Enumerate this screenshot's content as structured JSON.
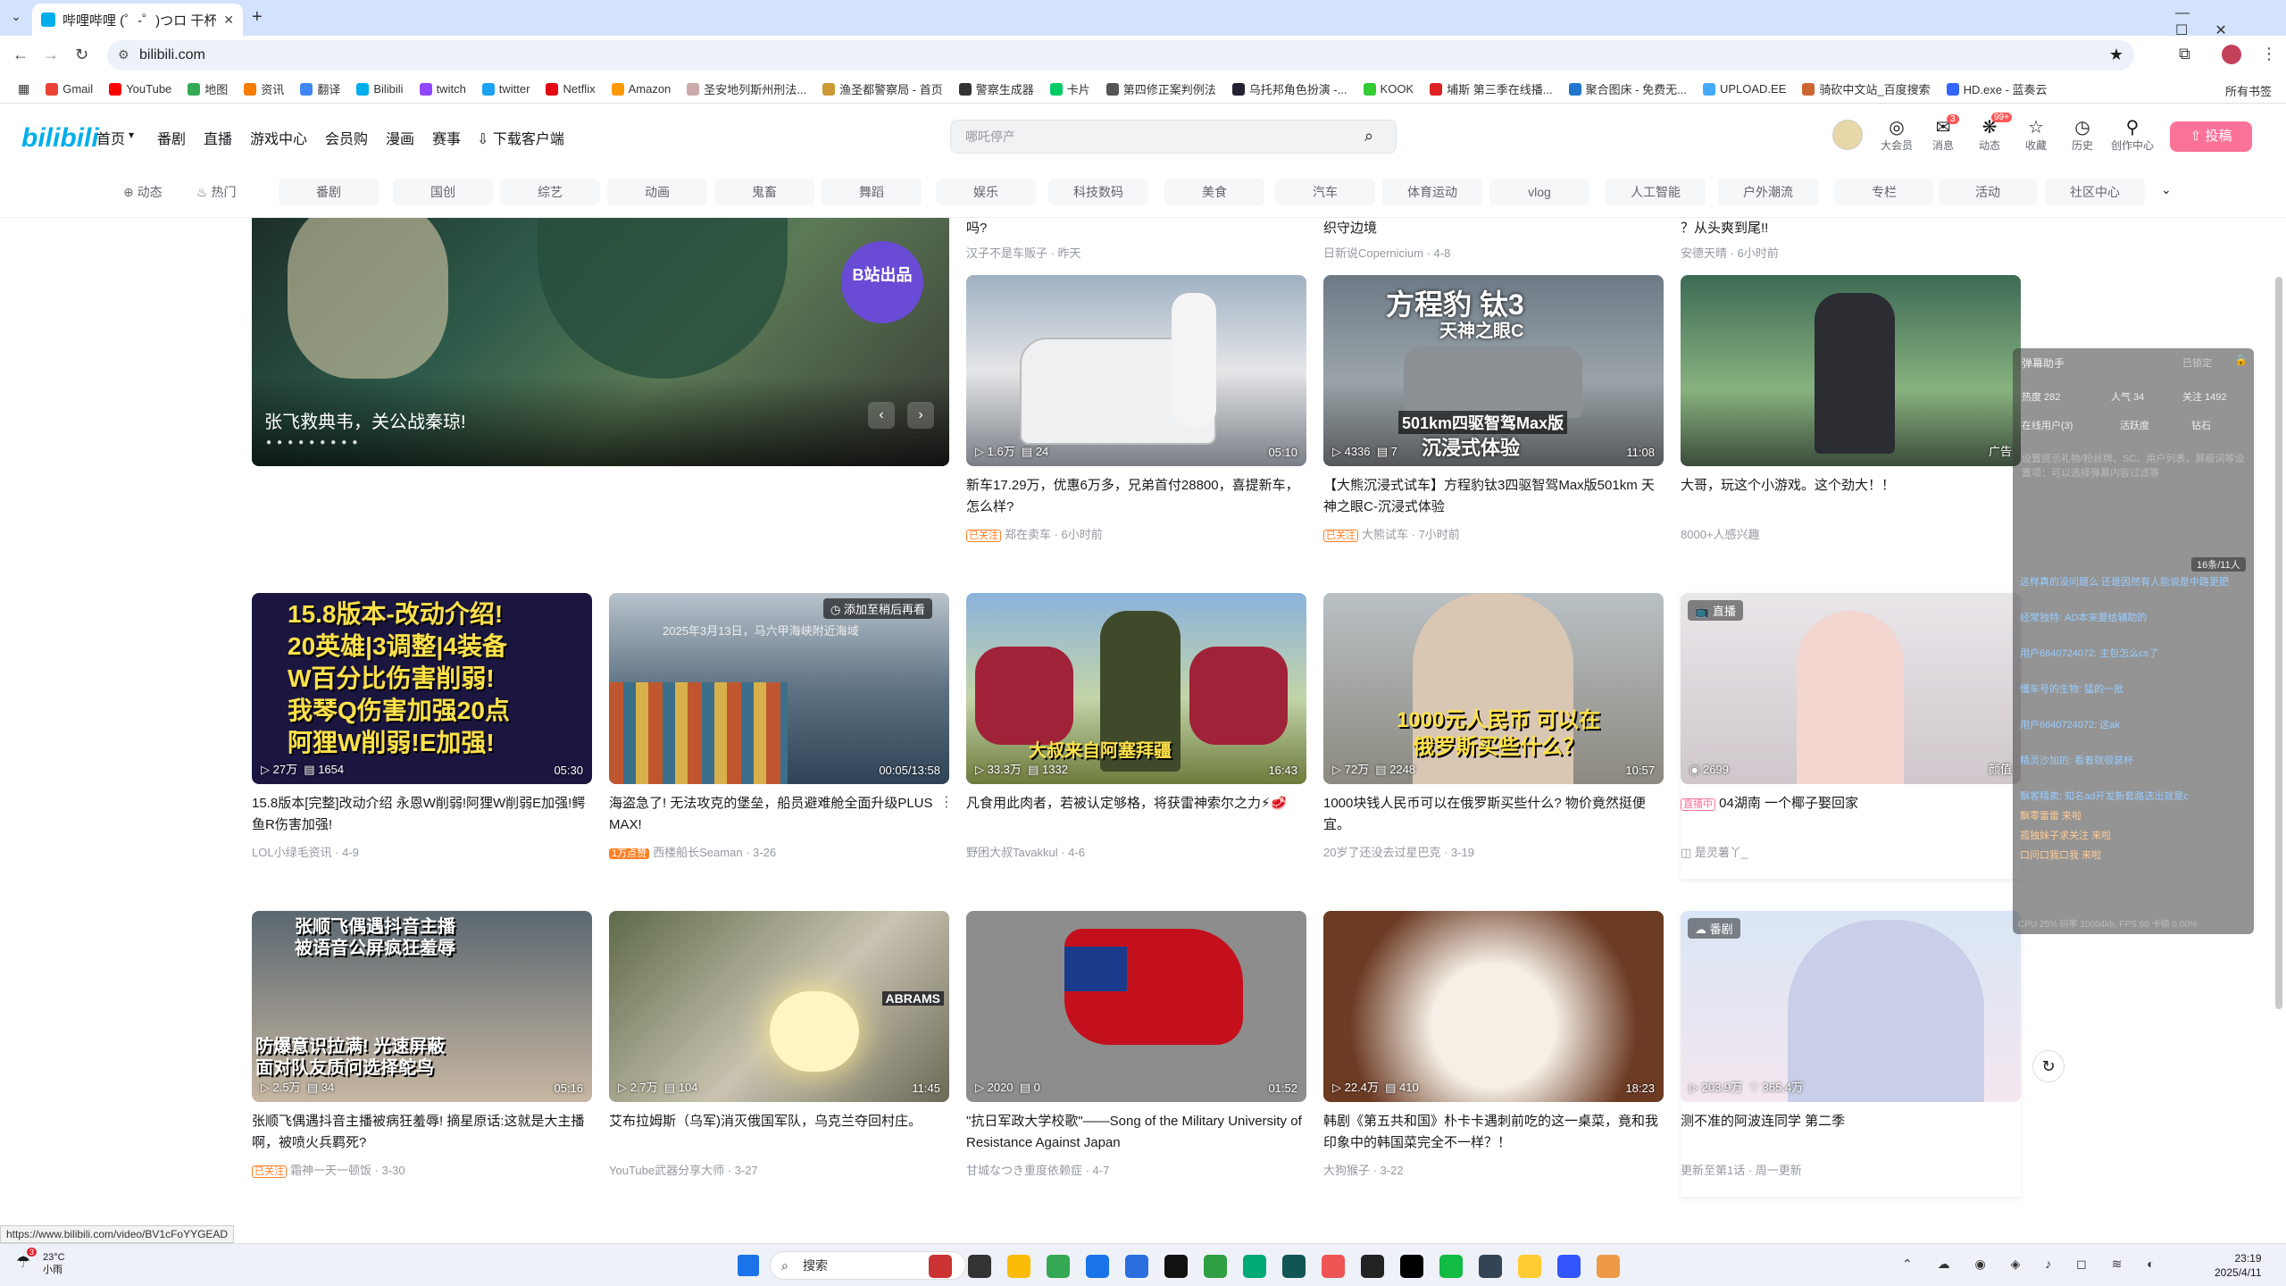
{
  "browser": {
    "tab_title": "哔哩哔哩 (゜-゜)つロ 干杯~-bili",
    "url": "bilibili.com",
    "status_url": "https://www.bilibili.com/video/BV1cFoYYGEAD"
  },
  "bookmarks": [
    "Gmail",
    "YouTube",
    "地图",
    "资讯",
    "翻译",
    "Bilibili",
    "twitch",
    "twitter",
    "Netflix",
    "Amazon",
    "圣安地列斯州刑法...",
    "渔圣都警察局 - 首页",
    "警察生成器",
    "卡片",
    "第四修正案判例法",
    "乌托邦角色扮演 -...",
    "KOOK",
    "埔斯 第三季在线播...",
    "聚合图床 - 免费无...",
    "UPLOAD.EE",
    "骑砍中文站_百度搜索",
    "HD.exe - 蓝奏云"
  ],
  "bookmarks_all": "所有书签",
  "header": {
    "logo": "bilibili",
    "nav": [
      "首页",
      "番剧",
      "直播",
      "游戏中心",
      "会员购",
      "漫画",
      "赛事",
      "下载客户端"
    ],
    "search_placeholder": "哪吒停产",
    "icons": [
      {
        "label": "大会员"
      },
      {
        "label": "消息",
        "badge": "3"
      },
      {
        "label": "动态",
        "badge": "99+"
      },
      {
        "label": "收藏"
      },
      {
        "label": "历史"
      },
      {
        "label": "创作中心"
      }
    ],
    "upload": "投稿"
  },
  "channels": {
    "dynamic": "动态",
    "hot": "热门",
    "items": [
      "番剧",
      "国创",
      "综艺",
      "动画",
      "鬼畜",
      "舞蹈",
      "娱乐",
      "科技数码",
      "美食",
      "汽车",
      "体育运动",
      "vlog",
      "人工智能",
      "户外潮流",
      "专栏",
      "活动",
      "社区中心"
    ]
  },
  "carousel": {
    "caption": "张飞救典韦，关公战秦琼!",
    "badge": "B站出品"
  },
  "top_partial": [
    {
      "title": "吗?",
      "meta": "汉子不是车贩子 · 昨天"
    },
    {
      "title": "织守边境",
      "meta": "日新说Copernicium · 4-8"
    },
    {
      "title": "？从头爽到尾!!",
      "meta": "安德天晴 · 6小时前"
    }
  ],
  "row1": [
    {
      "views": "1.6万",
      "comments": "24",
      "duration": "05:10",
      "title": "新车17.29万，优惠6万多，兄弟首付28800，喜提新车，怎么样?",
      "tag": "已关注",
      "author": "郑在卖车 · 6小时前"
    },
    {
      "views": "4336",
      "comments": "7",
      "duration": "11:08",
      "title": "【大熊沉浸式试车】方程豹钛3四驱智驾Max版501km 天神之眼C-沉浸式体验",
      "tag": "已关注",
      "author": "大熊试车 · 7小时前",
      "overlay1": "方程豹 钛3",
      "overlay2": "天神之眼C",
      "overlay3": "501km四驱智驾Max版",
      "overlay4": "沉浸式体验"
    },
    {
      "ad": "广告",
      "title": "大哥，玩这个小游戏。这个劲大！！",
      "author": "8000+人感兴趣"
    }
  ],
  "row2": [
    {
      "views": "27万",
      "comments": "1654",
      "duration": "05:30",
      "title": "15.8版本[完整]改动介绍 永恩W削弱!阿狸W削弱E加强!鳄鱼R伤害加强!",
      "author": "LOL小绿毛资讯 · 4-9",
      "lines": [
        "15.8版本-改动介绍!",
        "20英雄|3调整|4装备",
        "W百分比伤害削弱!",
        "我琴Q伤害加强20点",
        "阿狸W削弱!E加强!"
      ]
    },
    {
      "views": "",
      "comments": "",
      "duration": "00:05/13:58",
      "title": "海盗急了! 无法攻克的堡垒，船员避难舱全面升级PLUS MAX!",
      "tag": "1万点赞",
      "author": "西楼船长Seaman · 3-26",
      "watch_later": "添加至稍后再看",
      "date_overlay": "2025年3月13日，马六甲海峡附近海域"
    },
    {
      "views": "33.3万",
      "comments": "1332",
      "duration": "16:43",
      "title": "凡食用此肉者，若被认定够格，将获雷神索尔之力⚡🥩",
      "author": "野困大叔Tavakkul · 4-6",
      "overlay": "大叔来自阿塞拜疆"
    },
    {
      "views": "72万",
      "comments": "2248",
      "duration": "10:57",
      "title": "1000块钱人民币可以在俄罗斯买些什么? 物价竟然挺便宜。",
      "author": "20岁了还没去过星巴克 · 3-19",
      "overlay": "1000元人民币 可以在俄罗斯买些什么？"
    },
    {
      "live_badge": "直播",
      "views": "2699",
      "category": "颜值",
      "title": "04湖南 一个椰子娶回家",
      "live_tag": "直播中",
      "author": "是灵薯丫_"
    }
  ],
  "row3": [
    {
      "views": "2.5万",
      "comments": "34",
      "duration": "05:16",
      "title": "张顺飞偶遇抖音主播被病狂羞辱! 摘星原话:这就是大主播啊，被喷火兵羁死?",
      "tag": "已关注",
      "author": "霜神一天一顿饭 · 3-30",
      "overlay1": "张顺飞偶遇抖音主播",
      "overlay2": "被语音公屏疯狂羞辱",
      "overlay3": "防爆意识拉满! 光速屏蔽",
      "overlay4": "面对队友质问选择鸵鸟"
    },
    {
      "views": "2.7万",
      "comments": "104",
      "duration": "11:45",
      "title": "艾布拉姆斯（乌军)消灭俄国军队，乌克兰夺回村庄。",
      "author": "YouTube武器分享大师 · 3-27",
      "overlay": "ABRAMS"
    },
    {
      "views": "2020",
      "comments": "0",
      "duration": "01:52",
      "title": "\"抗日军政大学校歌\"——Song of the Military University of Resistance Against Japan",
      "author": "甘城なつき重度依赖症 · 4-7"
    },
    {
      "views": "22.4万",
      "comments": "410",
      "duration": "18:23",
      "title": "韩剧《第五共和国》朴卡卡遇刺前吃的这一桌菜，竟和我印象中的韩国菜完全不一样？！",
      "author": "大狗猴子 · 3-22"
    },
    {
      "bangumi_badge": "番剧",
      "views": "203.9万",
      "likes": "365.4万",
      "title": "测不准的阿波连同学 第二季",
      "author": "更新至第1话 · 周一更新"
    }
  ],
  "danmaku": {
    "title": "弹幕助手",
    "locked": "已锁定",
    "stats": [
      "热度 282",
      "人气 34",
      "关注 1492"
    ],
    "tabs": [
      "在线用户(3)",
      "活跃度",
      "钻石"
    ],
    "hint": "设置提示礼物/粉丝牌、SC、用户列表、屏蔽词等设置项：可以选择弹幕内容过滤等",
    "counter": "16条/11人",
    "messages": [
      "这样真的没问题么 还是因然有人能说是中路更肥",
      "经常独特: AD本来要给辅助的",
      "用户6640724072: 主包怎么cs了",
      "懂车号的生物: 猛的一批",
      "用户6640724072: 这ak",
      "精灵沙加的: 看着就很装杯",
      "飘客精卖: 知名ad开发新套路选出就是c",
      "飘零雷雷 来啦",
      "孤独妹子求关注 来啦",
      "口问口我口我 来啦"
    ],
    "footer": "CPU 25% 码率 10004kb, FPS 60 卡顿 0.00%"
  },
  "taskbar": {
    "weather_temp": "23°C",
    "weather_desc": "小雨",
    "weather_badge": "3",
    "search": "搜索",
    "time": "23:19",
    "date": "2025/4/11"
  }
}
